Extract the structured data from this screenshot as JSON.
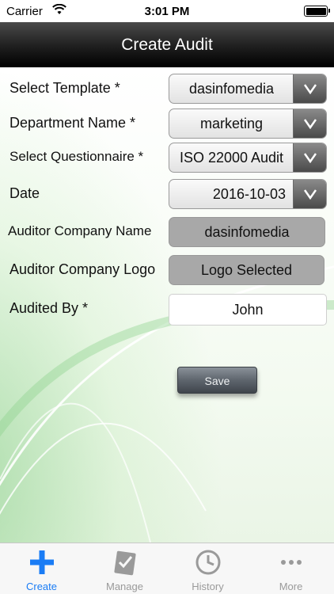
{
  "status_bar": {
    "carrier": "Carrier",
    "time": "3:01 PM"
  },
  "nav": {
    "title": "Create Audit"
  },
  "form": {
    "select_template": {
      "label": "Select Template *",
      "value": "dasinfomedia"
    },
    "department_name": {
      "label": "Department Name *",
      "value": "marketing"
    },
    "select_questionnaire": {
      "label": "Select Questionnaire *",
      "value": "ISO 22000 Audit"
    },
    "date": {
      "label": "Date",
      "value": "2016-10-03"
    },
    "auditor_company_name": {
      "label": "Auditor Company Name",
      "value": "dasinfomedia"
    },
    "auditor_company_logo": {
      "label": "Auditor Company Logo",
      "value": "Logo Selected"
    },
    "audited_by": {
      "label": "Audited By *",
      "value": "John"
    },
    "save_label": "Save"
  },
  "tabs": [
    {
      "label": "Create",
      "icon": "plus-icon",
      "active": true
    },
    {
      "label": "Manage",
      "icon": "clipboard-check-icon",
      "active": false
    },
    {
      "label": "History",
      "icon": "clock-icon",
      "active": false
    },
    {
      "label": "More",
      "icon": "ellipsis-icon",
      "active": false
    }
  ],
  "colors": {
    "active_tab": "#1a7cf5",
    "inactive_tab": "#9a9a9a",
    "nav_bg": "#1e1e1e"
  }
}
